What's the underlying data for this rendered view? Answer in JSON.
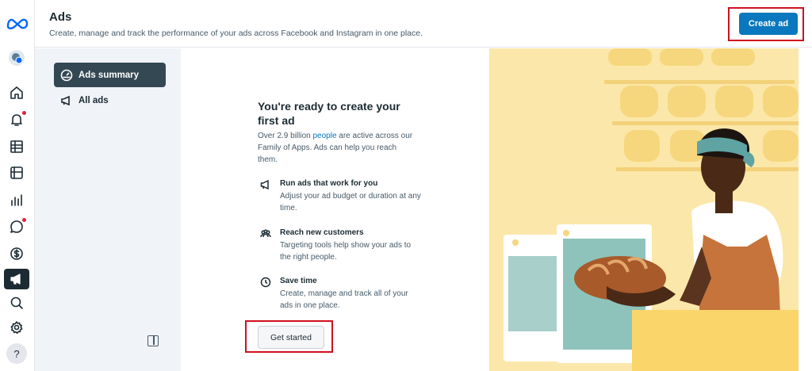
{
  "header": {
    "title": "Ads",
    "subtitle": "Create, manage and track the performance of your ads across Facebook and Instagram in one place.",
    "create_ad_label": "Create ad"
  },
  "rail": {
    "icons": [
      "meta-logo-icon",
      "account-avatar-icon",
      "home-icon",
      "notifications-icon",
      "table-icon",
      "pages-icon",
      "insights-icon",
      "messages-icon",
      "billing-icon",
      "ads-icon",
      "search-icon",
      "settings-icon",
      "help-icon"
    ]
  },
  "sidebar": {
    "items": [
      {
        "label": "Ads summary",
        "selected": true
      },
      {
        "label": "All ads",
        "selected": false
      }
    ]
  },
  "main": {
    "heading": "You're ready to create your first ad",
    "intro_before": "Over 2.9 billion ",
    "intro_link": "people",
    "intro_after": " are active across our Family of Apps. Ads can help you reach them.",
    "features": [
      {
        "title": "Run ads that work for you",
        "desc": "Adjust your ad budget or duration at any time.",
        "icon": "megaphone-icon"
      },
      {
        "title": "Reach new customers",
        "desc": "Targeting tools help show your ads to the right people.",
        "icon": "people-icon"
      },
      {
        "title": "Save time",
        "desc": "Create, manage and track all of your ads in one place.",
        "icon": "clock-icon"
      }
    ],
    "get_started_label": "Get started"
  },
  "colors": {
    "accent": "#0a78be",
    "highlight": "#d0101e",
    "illustration_bg": "#fbe7a9"
  }
}
